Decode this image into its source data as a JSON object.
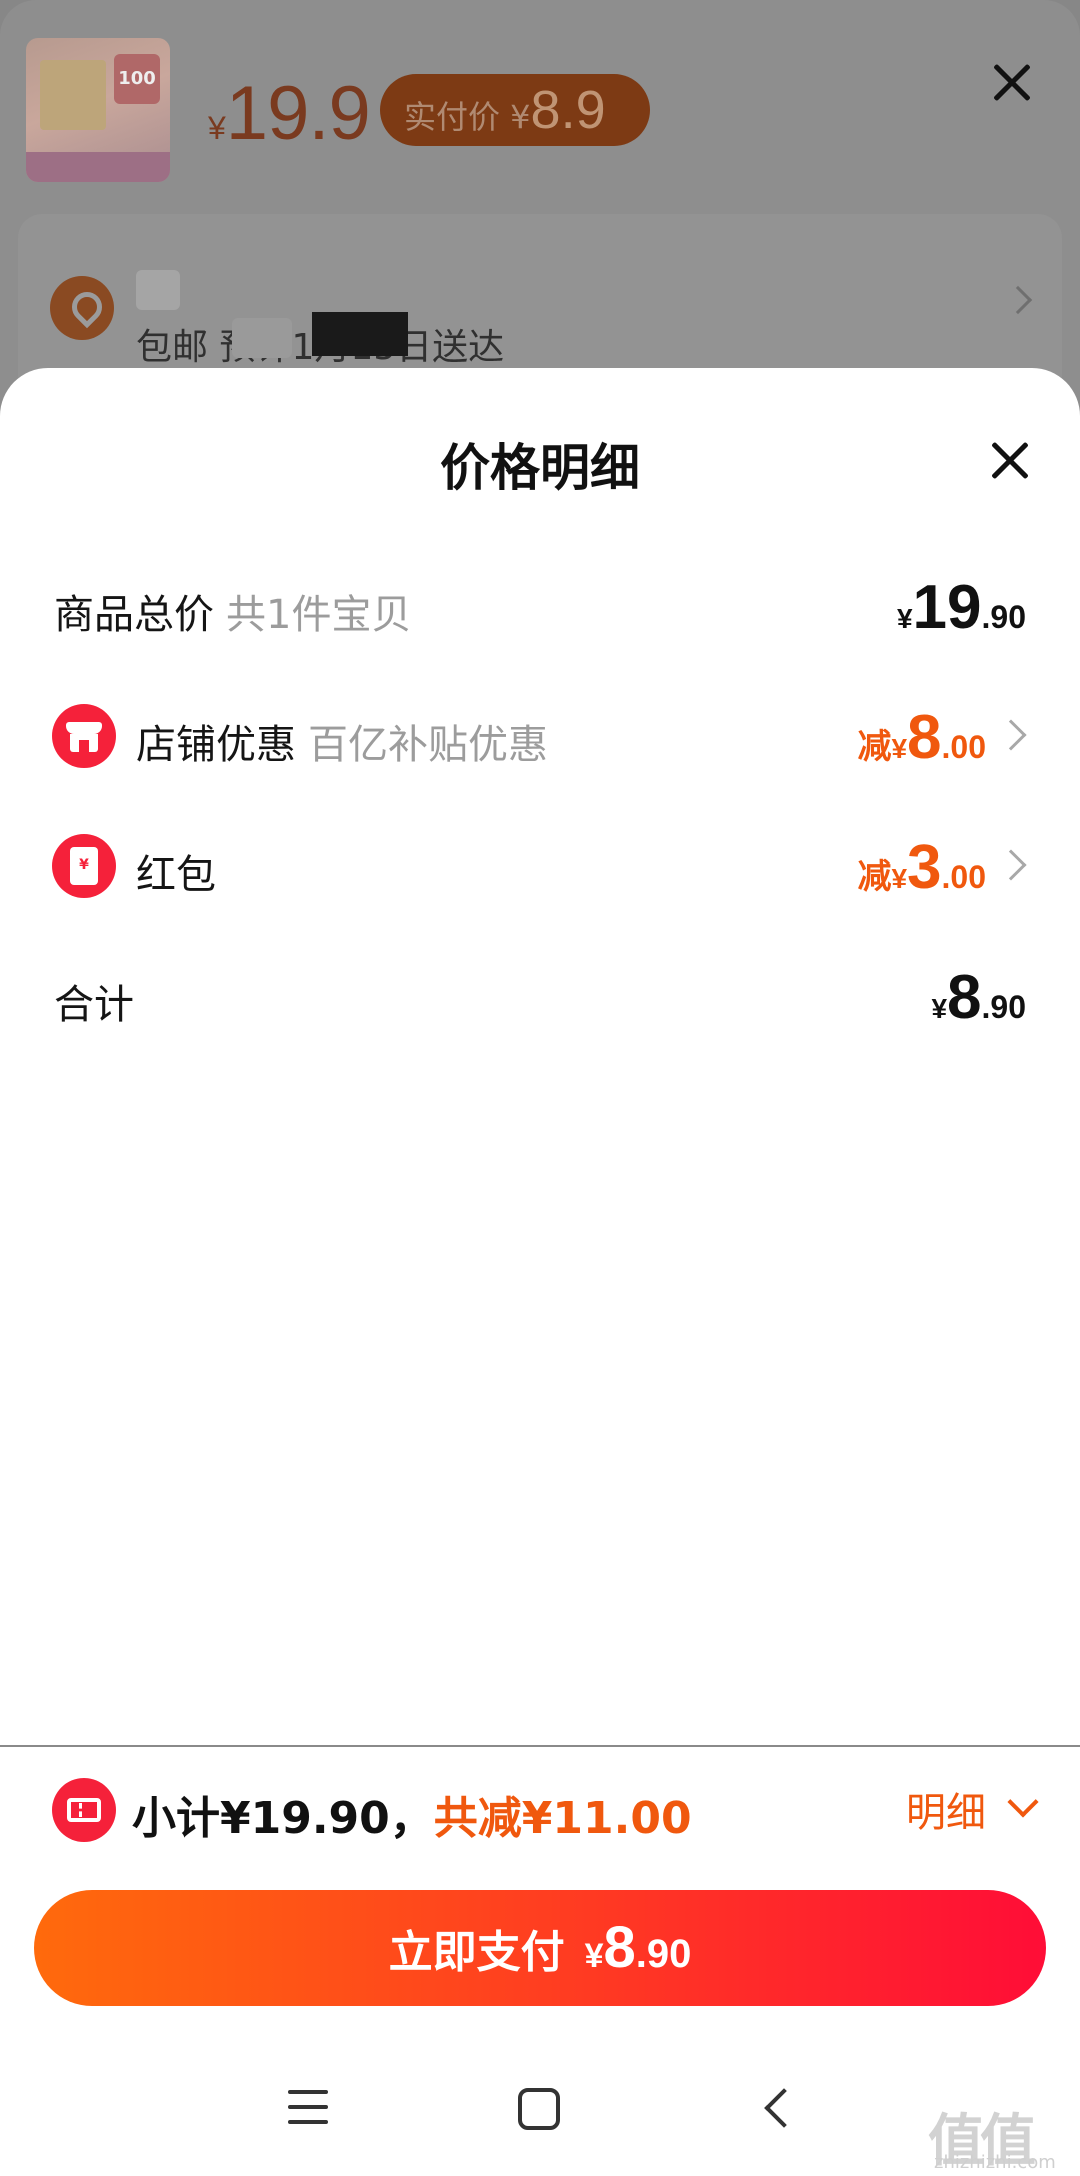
{
  "background": {
    "product": {
      "thumb_badge": "100",
      "price_symbol": "¥",
      "price": "19.9",
      "actual_label": "实付价 ¥",
      "actual_value": "8.9"
    },
    "delivery_text": "包邮    预计1月15日送达"
  },
  "modal": {
    "title": "价格明细",
    "rows": [
      {
        "label": "商品总价",
        "sub": "共1件宝贝",
        "prefix": "",
        "yen": "¥",
        "int": "19",
        "dec": ".90"
      },
      {
        "label": "店铺优惠",
        "sub": "百亿补贴优惠",
        "prefix": "减",
        "yen": "¥",
        "int": "8",
        "dec": ".00"
      },
      {
        "label": "红包",
        "sub": "",
        "prefix": "减",
        "yen": "¥",
        "int": "3",
        "dec": ".00",
        "icon_glyph": "¥"
      },
      {
        "label": "合计",
        "sub": "",
        "prefix": "",
        "yen": "¥",
        "int": "8",
        "dec": ".90"
      }
    ]
  },
  "bottom": {
    "subtotal": "小计¥19.90，",
    "discount": "共减¥11.00",
    "detail_label": "明细",
    "pay_label": "立即支付",
    "pay_yen": "¥",
    "pay_int": "8",
    "pay_dec": ".90"
  },
  "watermark": {
    "logo": "值值值",
    "site": "zhizhizhi.com"
  },
  "colors": {
    "accent": "#f0580e",
    "badge_red": "#f5213a",
    "pay_gradient_start": "#ff6a0c",
    "pay_gradient_end": "#ff0d37"
  },
  "icons": [
    "close-icon",
    "location-icon",
    "chevron-right-icon",
    "shop-icon",
    "red-packet-icon",
    "coupon-icon",
    "chevron-down-icon",
    "menu-icon",
    "home-icon",
    "back-icon"
  ]
}
